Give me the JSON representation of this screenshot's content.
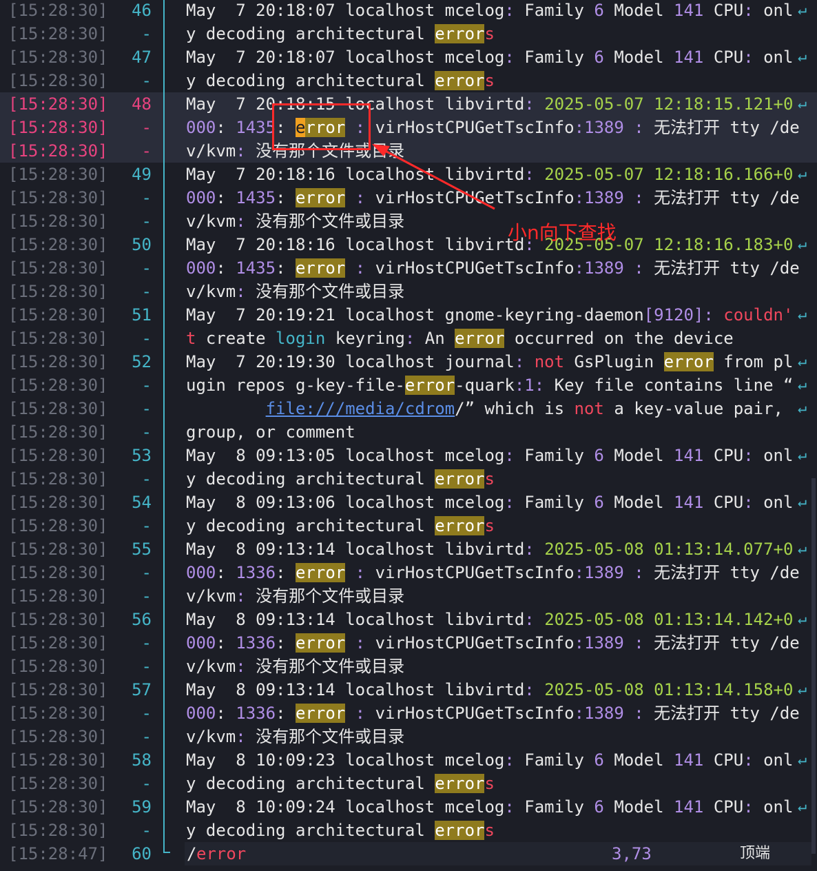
{
  "gutter": {
    "rows": [
      {
        "ts": "[15:28:30]",
        "ln": "46"
      },
      {
        "ts": "[15:28:30]",
        "ln": "-"
      },
      {
        "ts": "[15:28:30]",
        "ln": "47"
      },
      {
        "ts": "[15:28:30]",
        "ln": "-"
      },
      {
        "ts": "[15:28:30]",
        "ln": "48"
      },
      {
        "ts": "[15:28:30]",
        "ln": "-"
      },
      {
        "ts": "[15:28:30]",
        "ln": "-"
      },
      {
        "ts": "[15:28:30]",
        "ln": "49"
      },
      {
        "ts": "[15:28:30]",
        "ln": "-"
      },
      {
        "ts": "[15:28:30]",
        "ln": "-"
      },
      {
        "ts": "[15:28:30]",
        "ln": "50"
      },
      {
        "ts": "[15:28:30]",
        "ln": "-"
      },
      {
        "ts": "[15:28:30]",
        "ln": "-"
      },
      {
        "ts": "[15:28:30]",
        "ln": "51"
      },
      {
        "ts": "[15:28:30]",
        "ln": "-"
      },
      {
        "ts": "[15:28:30]",
        "ln": "52"
      },
      {
        "ts": "[15:28:30]",
        "ln": "-"
      },
      {
        "ts": "[15:28:30]",
        "ln": "-"
      },
      {
        "ts": "[15:28:30]",
        "ln": "-"
      },
      {
        "ts": "[15:28:30]",
        "ln": "53"
      },
      {
        "ts": "[15:28:30]",
        "ln": "-"
      },
      {
        "ts": "[15:28:30]",
        "ln": "54"
      },
      {
        "ts": "[15:28:30]",
        "ln": "-"
      },
      {
        "ts": "[15:28:30]",
        "ln": "55"
      },
      {
        "ts": "[15:28:30]",
        "ln": "-"
      },
      {
        "ts": "[15:28:30]",
        "ln": "-"
      },
      {
        "ts": "[15:28:30]",
        "ln": "56"
      },
      {
        "ts": "[15:28:30]",
        "ln": "-"
      },
      {
        "ts": "[15:28:30]",
        "ln": "-"
      },
      {
        "ts": "[15:28:30]",
        "ln": "57"
      },
      {
        "ts": "[15:28:30]",
        "ln": "-"
      },
      {
        "ts": "[15:28:30]",
        "ln": "-"
      },
      {
        "ts": "[15:28:30]",
        "ln": "58"
      },
      {
        "ts": "[15:28:30]",
        "ln": "-"
      },
      {
        "ts": "[15:28:30]",
        "ln": "59"
      },
      {
        "ts": "[15:28:30]",
        "ln": "-"
      },
      {
        "ts": "[15:28:47]",
        "ln": "60"
      }
    ]
  },
  "highlight_rows": [
    4,
    5,
    6
  ],
  "lines": [
    [
      [
        "w",
        "May  7 20:18:07 localhost mcelog"
      ],
      [
        "p",
        ":"
      ],
      [
        "w",
        " Family "
      ],
      [
        "p",
        "6"
      ],
      [
        "w",
        " Model "
      ],
      [
        "p",
        "141"
      ],
      [
        "w",
        " CPU"
      ],
      [
        "p",
        ":"
      ],
      [
        "w",
        " onl"
      ]
    ],
    [
      [
        "w",
        "y decoding architectural "
      ],
      [
        "m",
        "error"
      ],
      [
        "r",
        "s"
      ]
    ],
    [
      [
        "w",
        "May  7 20:18:07 localhost mcelog"
      ],
      [
        "p",
        ":"
      ],
      [
        "w",
        " Family "
      ],
      [
        "p",
        "6"
      ],
      [
        "w",
        " Model "
      ],
      [
        "p",
        "141"
      ],
      [
        "w",
        " CPU"
      ],
      [
        "p",
        ":"
      ],
      [
        "w",
        " onl"
      ]
    ],
    [
      [
        "w",
        "y decoding architectural "
      ],
      [
        "m",
        "error"
      ],
      [
        "r",
        "s"
      ]
    ],
    [
      [
        "w",
        "May  7 20:18:15 localhost libvirtd"
      ],
      [
        "p",
        ":"
      ],
      [
        "w",
        " "
      ],
      [
        "g",
        "2025-05-07 12:18:15.121+0"
      ]
    ],
    [
      [
        "p",
        "000"
      ],
      [
        "w",
        ": "
      ],
      [
        "p",
        "1435"
      ],
      [
        "w",
        ": "
      ],
      [
        "cur",
        "e"
      ],
      [
        "m",
        "rror"
      ],
      [
        "w",
        " "
      ],
      [
        "p",
        ":"
      ],
      [
        "w",
        " virHostCPUGetTscInfo"
      ],
      [
        "p",
        ":"
      ],
      [
        "p",
        "1389"
      ],
      [
        "w",
        " "
      ],
      [
        "p",
        ":"
      ],
      [
        "w",
        " 无法打开 tty /de"
      ]
    ],
    [
      [
        "w",
        "v/kvm"
      ],
      [
        "p",
        ":"
      ],
      [
        "w",
        " 没有那个文件或目录"
      ]
    ],
    [
      [
        "w",
        "May  7 20:18:16 localhost libvirtd"
      ],
      [
        "p",
        ":"
      ],
      [
        "w",
        " "
      ],
      [
        "g",
        "2025-05-07 12:18:16.166+0"
      ]
    ],
    [
      [
        "p",
        "000"
      ],
      [
        "w",
        ": "
      ],
      [
        "p",
        "1435"
      ],
      [
        "w",
        ": "
      ],
      [
        "m",
        "error"
      ],
      [
        "w",
        " "
      ],
      [
        "p",
        ":"
      ],
      [
        "w",
        " virHostCPUGetTscInfo"
      ],
      [
        "p",
        ":"
      ],
      [
        "p",
        "1389"
      ],
      [
        "w",
        " "
      ],
      [
        "p",
        ":"
      ],
      [
        "w",
        " 无法打开 tty /de"
      ]
    ],
    [
      [
        "w",
        "v/kvm"
      ],
      [
        "p",
        ":"
      ],
      [
        "w",
        " 没有那个文件或目录"
      ]
    ],
    [
      [
        "w",
        "May  7 20:18:16 localhost libvirtd"
      ],
      [
        "p",
        ":"
      ],
      [
        "w",
        " "
      ],
      [
        "g",
        "2025-05-07 12:18:16.183+0"
      ]
    ],
    [
      [
        "p",
        "000"
      ],
      [
        "w",
        ": "
      ],
      [
        "p",
        "1435"
      ],
      [
        "w",
        ": "
      ],
      [
        "m",
        "error"
      ],
      [
        "w",
        " "
      ],
      [
        "p",
        ":"
      ],
      [
        "w",
        " virHostCPUGetTscInfo"
      ],
      [
        "p",
        ":"
      ],
      [
        "p",
        "1389"
      ],
      [
        "w",
        " "
      ],
      [
        "p",
        ":"
      ],
      [
        "w",
        " 无法打开 tty /de"
      ]
    ],
    [
      [
        "w",
        "v/kvm"
      ],
      [
        "p",
        ":"
      ],
      [
        "w",
        " 没有那个文件或目录"
      ]
    ],
    [
      [
        "w",
        "May  7 20:19:21 localhost gnome-keyring-daemon"
      ],
      [
        "p",
        "["
      ],
      [
        "p",
        "9120"
      ],
      [
        "p",
        "]"
      ],
      [
        "p",
        ":"
      ],
      [
        "w",
        " "
      ],
      [
        "r",
        "couldn'"
      ]
    ],
    [
      [
        "r",
        "t"
      ],
      [
        "w",
        " create "
      ],
      [
        "c",
        "login"
      ],
      [
        "w",
        " keyring"
      ],
      [
        "p",
        ":"
      ],
      [
        "w",
        " An "
      ],
      [
        "m",
        "error"
      ],
      [
        "w",
        " occurred on the device"
      ]
    ],
    [
      [
        "w",
        "May  7 20:19:30 localhost journal"
      ],
      [
        "p",
        ":"
      ],
      [
        "w",
        " "
      ],
      [
        "r",
        "not"
      ],
      [
        "w",
        " GsPlugin "
      ],
      [
        "m",
        "error"
      ],
      [
        "w",
        " from pl"
      ]
    ],
    [
      [
        "w",
        "ugin repos g-key-file-"
      ],
      [
        "m",
        "error"
      ],
      [
        "w",
        "-quark"
      ],
      [
        "p",
        ":"
      ],
      [
        "p",
        "1"
      ],
      [
        "p",
        ":"
      ],
      [
        "w",
        " Key file contains line “"
      ]
    ],
    [
      [
        "w",
        "        "
      ],
      [
        "url",
        "file:///media/cdrom"
      ],
      [
        "w",
        "/” which is "
      ],
      [
        "r",
        "not"
      ],
      [
        "w",
        " a key-value pair,"
      ]
    ],
    [
      [
        "w",
        "group, or comment"
      ]
    ],
    [
      [
        "w",
        "May  8 09:13:05 localhost mcelog"
      ],
      [
        "p",
        ":"
      ],
      [
        "w",
        " Family "
      ],
      [
        "p",
        "6"
      ],
      [
        "w",
        " Model "
      ],
      [
        "p",
        "141"
      ],
      [
        "w",
        " CPU"
      ],
      [
        "p",
        ":"
      ],
      [
        "w",
        " onl"
      ]
    ],
    [
      [
        "w",
        "y decoding architectural "
      ],
      [
        "m",
        "error"
      ],
      [
        "r",
        "s"
      ]
    ],
    [
      [
        "w",
        "May  8 09:13:06 localhost mcelog"
      ],
      [
        "p",
        ":"
      ],
      [
        "w",
        " Family "
      ],
      [
        "p",
        "6"
      ],
      [
        "w",
        " Model "
      ],
      [
        "p",
        "141"
      ],
      [
        "w",
        " CPU"
      ],
      [
        "p",
        ":"
      ],
      [
        "w",
        " onl"
      ]
    ],
    [
      [
        "w",
        "y decoding architectural "
      ],
      [
        "m",
        "error"
      ],
      [
        "r",
        "s"
      ]
    ],
    [
      [
        "w",
        "May  8 09:13:14 localhost libvirtd"
      ],
      [
        "p",
        ":"
      ],
      [
        "w",
        " "
      ],
      [
        "g",
        "2025-05-08 01:13:14.077+0"
      ]
    ],
    [
      [
        "p",
        "000"
      ],
      [
        "w",
        ": "
      ],
      [
        "p",
        "1336"
      ],
      [
        "w",
        ": "
      ],
      [
        "m",
        "error"
      ],
      [
        "w",
        " "
      ],
      [
        "p",
        ":"
      ],
      [
        "w",
        " virHostCPUGetTscInfo"
      ],
      [
        "p",
        ":"
      ],
      [
        "p",
        "1389"
      ],
      [
        "w",
        " "
      ],
      [
        "p",
        ":"
      ],
      [
        "w",
        " 无法打开 tty /de"
      ]
    ],
    [
      [
        "w",
        "v/kvm"
      ],
      [
        "p",
        ":"
      ],
      [
        "w",
        " 没有那个文件或目录"
      ]
    ],
    [
      [
        "w",
        "May  8 09:13:14 localhost libvirtd"
      ],
      [
        "p",
        ":"
      ],
      [
        "w",
        " "
      ],
      [
        "g",
        "2025-05-08 01:13:14.142+0"
      ]
    ],
    [
      [
        "p",
        "000"
      ],
      [
        "w",
        ": "
      ],
      [
        "p",
        "1336"
      ],
      [
        "w",
        ": "
      ],
      [
        "m",
        "error"
      ],
      [
        "w",
        " "
      ],
      [
        "p",
        ":"
      ],
      [
        "w",
        " virHostCPUGetTscInfo"
      ],
      [
        "p",
        ":"
      ],
      [
        "p",
        "1389"
      ],
      [
        "w",
        " "
      ],
      [
        "p",
        ":"
      ],
      [
        "w",
        " 无法打开 tty /de"
      ]
    ],
    [
      [
        "w",
        "v/kvm"
      ],
      [
        "p",
        ":"
      ],
      [
        "w",
        " 没有那个文件或目录"
      ]
    ],
    [
      [
        "w",
        "May  8 09:13:14 localhost libvirtd"
      ],
      [
        "p",
        ":"
      ],
      [
        "w",
        " "
      ],
      [
        "g",
        "2025-05-08 01:13:14.158+0"
      ]
    ],
    [
      [
        "p",
        "000"
      ],
      [
        "w",
        ": "
      ],
      [
        "p",
        "1336"
      ],
      [
        "w",
        ": "
      ],
      [
        "m",
        "error"
      ],
      [
        "w",
        " "
      ],
      [
        "p",
        ":"
      ],
      [
        "w",
        " virHostCPUGetTscInfo"
      ],
      [
        "p",
        ":"
      ],
      [
        "p",
        "1389"
      ],
      [
        "w",
        " "
      ],
      [
        "p",
        ":"
      ],
      [
        "w",
        " 无法打开 tty /de"
      ]
    ],
    [
      [
        "w",
        "v/kvm"
      ],
      [
        "p",
        ":"
      ],
      [
        "w",
        " 没有那个文件或目录"
      ]
    ],
    [
      [
        "w",
        "May  8 10:09:23 localhost mcelog"
      ],
      [
        "p",
        ":"
      ],
      [
        "w",
        " Family "
      ],
      [
        "p",
        "6"
      ],
      [
        "w",
        " Model "
      ],
      [
        "p",
        "141"
      ],
      [
        "w",
        " CPU"
      ],
      [
        "p",
        ":"
      ],
      [
        "w",
        " onl"
      ]
    ],
    [
      [
        "w",
        "y decoding architectural "
      ],
      [
        "m",
        "error"
      ],
      [
        "r",
        "s"
      ]
    ],
    [
      [
        "w",
        "May  8 10:09:24 localhost mcelog"
      ],
      [
        "p",
        ":"
      ],
      [
        "w",
        " Family "
      ],
      [
        "p",
        "6"
      ],
      [
        "w",
        " Model "
      ],
      [
        "p",
        "141"
      ],
      [
        "w",
        " CPU"
      ],
      [
        "p",
        ":"
      ],
      [
        "w",
        " onl"
      ]
    ],
    [
      [
        "w",
        "y decoding architectural "
      ],
      [
        "m",
        "error"
      ],
      [
        "r",
        "s"
      ]
    ]
  ],
  "wrap_rows": [
    0,
    2,
    4,
    7,
    10,
    13,
    15,
    16,
    17,
    19,
    21,
    23,
    26,
    29,
    32,
    34
  ],
  "wrap_glyph": "↵",
  "cmdline": {
    "slash": "/",
    "pattern": "error",
    "position": "3,73",
    "scroll": "顶端"
  },
  "annotation": {
    "label": "小n向下查找"
  },
  "colors": {
    "match_bg": "#8f7b1e",
    "cursor_bg": "#f0a020",
    "annotation": "#ff2a2a",
    "gutter_accent": "#45b5c8",
    "current_line": "#e8437f"
  }
}
